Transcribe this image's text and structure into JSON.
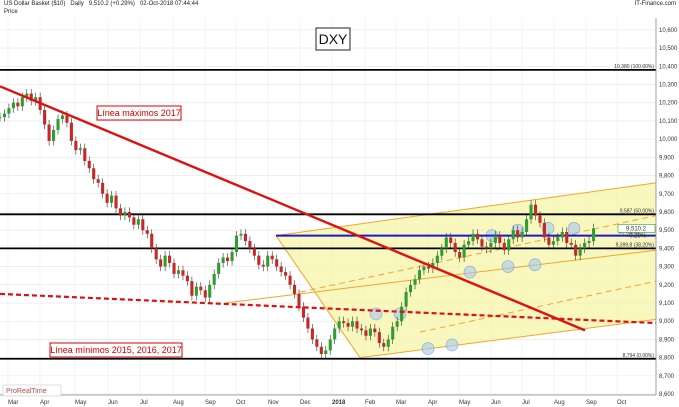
{
  "header": {
    "title": "US Dollar Basket ($10)",
    "interval": "Daily",
    "quote": "9,510.2 (+0.29%)",
    "datetime": "02-Oct-2018 07:44:44",
    "brand": "IT-Finance.com",
    "price_label": "Price"
  },
  "watermark": "ProRealTime",
  "chart_data": {
    "type": "line",
    "title": "DXY",
    "xlabel": "",
    "ylabel": "",
    "x_ticks": [
      "Mar",
      "Apr",
      "May",
      "Jun",
      "Jul",
      "Aug",
      "Sep",
      "Oct",
      "Nov",
      "Dec",
      "2018",
      "Feb",
      "Mar",
      "Apr",
      "May",
      "Jun",
      "Jul",
      "Aug",
      "Sep",
      "Oct"
    ],
    "y_ticks": [
      8600,
      8700,
      8800,
      8900,
      9000,
      9100,
      9200,
      9300,
      9400,
      9500,
      9600,
      9700,
      9800,
      9900,
      10000,
      10100,
      10200,
      10300,
      10400,
      10500,
      10600
    ],
    "y_tick_labels": [
      "8,600",
      "8,700",
      "8,800",
      "8,900",
      "9,000",
      "9,100",
      "9,200",
      "9,300",
      "9,400",
      "9,500",
      "9,600",
      "9,700",
      "9,800",
      "9,900",
      "10,000",
      "10,100",
      "10,200",
      "10,300",
      "10,400",
      "10,500",
      "10,600"
    ],
    "ylim": [
      8595,
      10665
    ],
    "grid": true,
    "last_price": 9510.2,
    "last_price_label": "9,510.2",
    "last_change_label": "+0.29%",
    "ref_price_label": "9,469.6",
    "series": [
      {
        "values": [
          10120,
          10140,
          10170,
          10200,
          10180,
          10230,
          10250,
          10210,
          10230,
          10160,
          10080,
          9990,
          10050,
          10110,
          10130,
          10090,
          9990,
          9940,
          9950,
          9880,
          9840,
          9780,
          9760,
          9700,
          9650,
          9690,
          9620,
          9580,
          9600,
          9570,
          9530,
          9560,
          9500,
          9480,
          9400,
          9340,
          9300,
          9360,
          9320,
          9260,
          9280,
          9250,
          9220,
          9140,
          9190,
          9170,
          9130,
          9200,
          9260,
          9320,
          9350,
          9330,
          9380,
          9470,
          9480,
          9440,
          9400,
          9360,
          9310,
          9300,
          9360,
          9340,
          9300,
          9270,
          9250,
          9200,
          9150,
          9080,
          9020,
          8960,
          8900,
          8860,
          8820,
          8840,
          8900,
          8960,
          9000,
          8990,
          8970,
          9000,
          8960,
          8950,
          8920,
          8960,
          8940,
          8880,
          8860,
          8900,
          8970,
          9000,
          9080,
          9160,
          9200,
          9230,
          9280,
          9300,
          9290,
          9320,
          9360,
          9400,
          9460,
          9430,
          9380,
          9350,
          9420,
          9440,
          9480,
          9450,
          9410,
          9400,
          9430,
          9470,
          9430,
          9390,
          9450,
          9500,
          9460,
          9490,
          9560,
          9640,
          9580,
          9540,
          9460,
          9420,
          9440,
          9460,
          9490,
          9430,
          9420,
          9360,
          9400,
          9430,
          9440,
          9510
        ]
      }
    ],
    "levels": [
      {
        "name": "10,380 (100.00%)",
        "value": 10380
      },
      {
        "name": "9,587 (50.00%)",
        "value": 9587
      },
      {
        "name": "9,469.6",
        "value": 9470
      },
      {
        "name": "9,399.8 (38.20%)",
        "value": 9400
      },
      {
        "name": "8,794 (0.00%)",
        "value": 8794
      }
    ],
    "annotations": [
      {
        "text": "Línea máximos 2017"
      },
      {
        "text": "Línea mínimos 2015, 2016, 2017"
      }
    ]
  }
}
